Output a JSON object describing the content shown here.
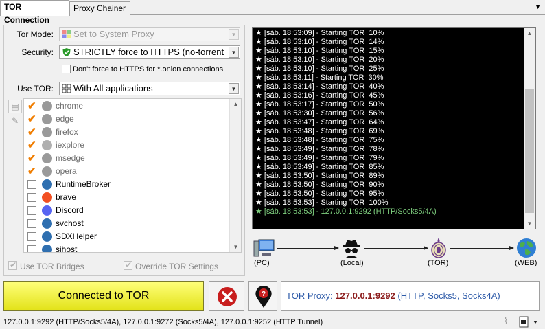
{
  "tabs": [
    {
      "label": "TOR Connection"
    },
    {
      "label": "Proxy Chainer"
    }
  ],
  "form": {
    "tor_mode_label": "Tor Mode:",
    "tor_mode_value": "Set to System Proxy",
    "security_label": "Security:",
    "security_value": "STRICTLY force to HTTPS (no-torrent",
    "onion_checkbox_label": "Don't force to HTTPS for *.onion connections",
    "use_tor_label": "Use TOR:",
    "use_tor_value": "With All applications"
  },
  "apps": [
    {
      "name": "chrome",
      "checked": true,
      "color": "#9a9a9a"
    },
    {
      "name": "edge",
      "checked": true,
      "color": "#9a9a9a"
    },
    {
      "name": "firefox",
      "checked": true,
      "color": "#9a9a9a"
    },
    {
      "name": "iexplore",
      "checked": true,
      "color": "#b0b0b0"
    },
    {
      "name": "msedge",
      "checked": true,
      "color": "#9a9a9a"
    },
    {
      "name": "opera",
      "checked": true,
      "color": "#9a9a9a"
    },
    {
      "name": "RuntimeBroker",
      "checked": false,
      "color": "#2f6fb0"
    },
    {
      "name": "brave",
      "checked": false,
      "color": "#f25022"
    },
    {
      "name": "Discord",
      "checked": false,
      "color": "#5865f2"
    },
    {
      "name": "svchost",
      "checked": false,
      "color": "#2f6fb0"
    },
    {
      "name": "SDXHelper",
      "checked": false,
      "color": "#2f6fb0"
    },
    {
      "name": "sihost",
      "checked": false,
      "color": "#2f6fb0"
    }
  ],
  "options": {
    "use_bridges_label": "Use TOR Bridges",
    "override_label": "Override TOR Settings"
  },
  "log": [
    "★ [sáb. 18:53:09] - Starting TOR  10%",
    "★ [sáb. 18:53:10] - Starting TOR  14%",
    "★ [sáb. 18:53:10] - Starting TOR  15%",
    "★ [sáb. 18:53:10] - Starting TOR  20%",
    "★ [sáb. 18:53:10] - Starting TOR  25%",
    "★ [sáb. 18:53:11] - Starting TOR  30%",
    "★ [sáb. 18:53:14] - Starting TOR  40%",
    "★ [sáb. 18:53:16] - Starting TOR  45%",
    "★ [sáb. 18:53:17] - Starting TOR  50%",
    "★ [sáb. 18:53:30] - Starting TOR  56%",
    "★ [sáb. 18:53:47] - Starting TOR  64%",
    "★ [sáb. 18:53:48] - Starting TOR  69%",
    "★ [sáb. 18:53:48] - Starting TOR  75%",
    "★ [sáb. 18:53:49] - Starting TOR  78%",
    "★ [sáb. 18:53:49] - Starting TOR  79%",
    "★ [sáb. 18:53:49] - Starting TOR  85%",
    "★ [sáb. 18:53:50] - Starting TOR  89%",
    "★ [sáb. 18:53:50] - Starting TOR  90%",
    "★ [sáb. 18:53:50] - Starting TOR  95%",
    "★ [sáb. 18:53:53] - Starting TOR  100%",
    "★ [sáb. 18:53:53] - 127.0.0.1:9292 (HTTP/Socks5/4A)"
  ],
  "diagram": {
    "pc": "(PC)",
    "local": "(Local)",
    "tor": "(TOR)",
    "web": "(WEB)"
  },
  "connect_button": "Connected to TOR",
  "proxy": {
    "prefix": "TOR Proxy:",
    "address": "127.0.0.1:9292",
    "protocols": "(HTTP, Socks5, Socks4A)"
  },
  "status_text": "127.0.0.1:9292 (HTTP/Socks5/4A), 127.0.0.1:9272 (Socks5/4A), 127.0.0.1:9252 (HTTP Tunnel)",
  "colors": {
    "checkmark": "#f07d00",
    "connect_bg": "#eded3a",
    "proxy_address": "#8b1a1a",
    "proxy_text": "#2d5aa8",
    "log_ok": "#7fd07f"
  }
}
